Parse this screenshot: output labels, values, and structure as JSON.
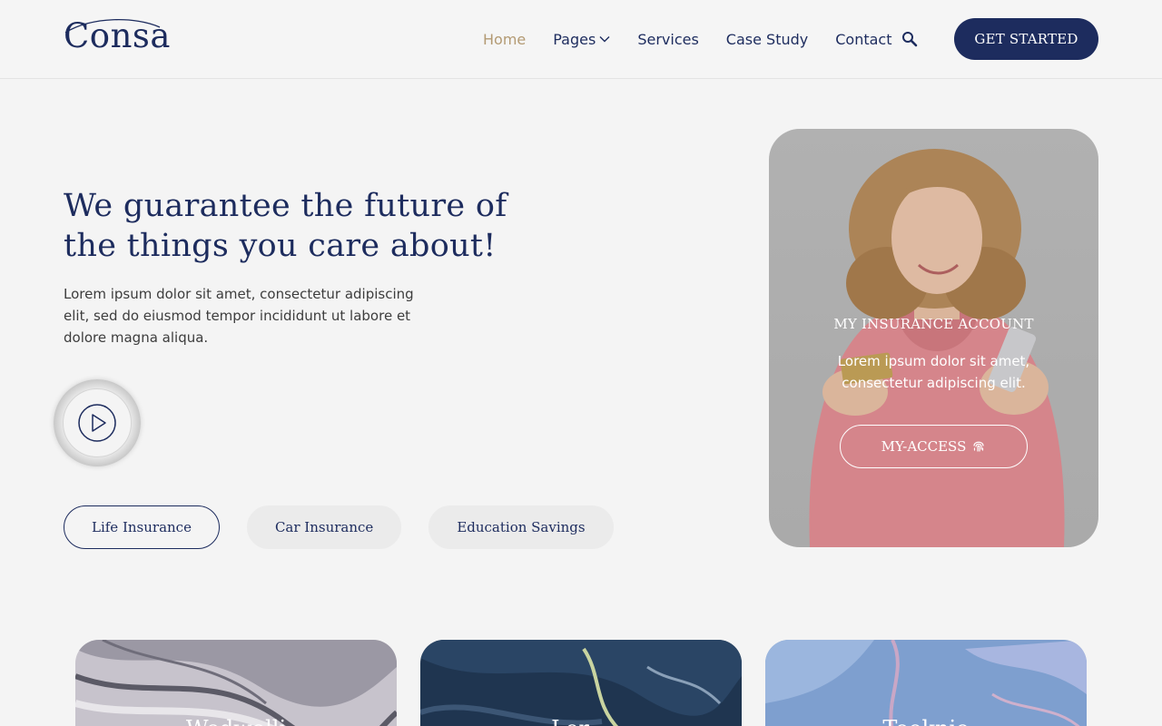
{
  "brand": {
    "logo_text": "Consa"
  },
  "nav": {
    "items": [
      {
        "label": "Home",
        "active": true
      },
      {
        "label": "Pages",
        "has_dropdown": true
      },
      {
        "label": "Services"
      },
      {
        "label": "Case Study"
      },
      {
        "label": "Contact"
      }
    ],
    "search_icon": "search-icon",
    "cta_label": "GET STARTED"
  },
  "hero": {
    "title": "We guarantee the future of the things you care about!",
    "text": "Lorem ipsum dolor sit amet, consectetur adipiscing elit, sed do eiusmod tempor incididunt ut labore et dolore magna aliqua.",
    "play_icon": "play-icon",
    "pills": [
      {
        "label": "Life Insurance",
        "active": true
      },
      {
        "label": "Car Insurance"
      },
      {
        "label": "Education Savings"
      }
    ]
  },
  "account": {
    "title": "MY INSURANCE ACCOUNT",
    "text": "Lorem ipsum dolor sit amet, consectetur adipiscing elit.",
    "button_label": "MY-ACCESS",
    "button_icon": "fingerprint-icon"
  },
  "cards": [
    {
      "label": "Wedwolli"
    },
    {
      "label": "Lor…"
    },
    {
      "label": "Tooknio"
    }
  ],
  "colors": {
    "brand_navy": "#1d2c5e",
    "accent_gold": "#b39a73",
    "background": "#f4f4f4"
  }
}
